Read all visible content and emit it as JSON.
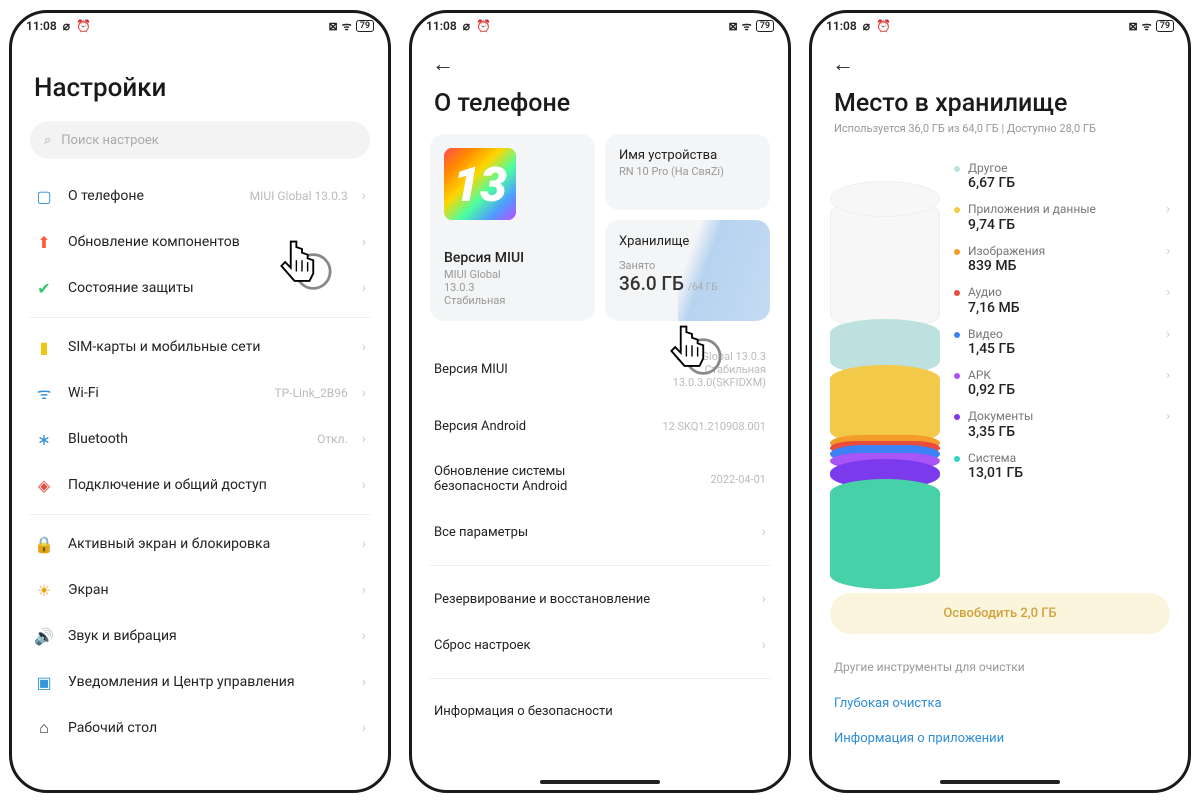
{
  "status": {
    "time": "11:08"
  },
  "screen1": {
    "title": "Настройки",
    "search_placeholder": "Поиск настроек",
    "g1": [
      {
        "id": "about-phone",
        "icon": "▢",
        "color": "#2e8dd9",
        "label": "О телефоне",
        "hint": "MIUI Global 13.0.3"
      },
      {
        "id": "update-components",
        "icon": "⬆",
        "color": "#ff5a3c",
        "label": "Обновление компонентов",
        "hint": ""
      },
      {
        "id": "security-status",
        "icon": "✔",
        "color": "#2ecc71",
        "label": "Состояние защиты",
        "hint": ""
      }
    ],
    "g2": [
      {
        "id": "sim-networks",
        "icon": "▮",
        "color": "#f1c40f",
        "label": "SIM-карты и мобильные сети",
        "hint": ""
      },
      {
        "id": "wifi",
        "icon": "ᯤ",
        "color": "#2e8dd9",
        "label": "Wi-Fi",
        "hint": "TP-Link_2B96"
      },
      {
        "id": "bluetooth",
        "icon": "∗",
        "color": "#2e8dd9",
        "label": "Bluetooth",
        "hint": "Откл."
      },
      {
        "id": "connection-sharing",
        "icon": "◈",
        "color": "#e74c3c",
        "label": "Подключение и общий доступ",
        "hint": ""
      }
    ],
    "g3": [
      {
        "id": "lock-screen",
        "icon": "🔒",
        "color": "#e74c3c",
        "label": "Активный экран и блокировка",
        "hint": ""
      },
      {
        "id": "display",
        "icon": "☀",
        "color": "#f39c12",
        "label": "Экран",
        "hint": ""
      },
      {
        "id": "sound",
        "icon": "🔊",
        "color": "#2ecc71",
        "label": "Звук и вибрация",
        "hint": ""
      },
      {
        "id": "notifications",
        "icon": "▣",
        "color": "#3498db",
        "label": "Уведомления и Центр управления",
        "hint": ""
      },
      {
        "id": "home-screen",
        "icon": "⌂",
        "color": "#333",
        "label": "Рабочий стол",
        "hint": ""
      }
    ]
  },
  "screen2": {
    "title": "О телефоне",
    "miui_card": {
      "label": "Версия MIUI",
      "line1": "MIUI Global",
      "line2": "13.0.3",
      "line3": "Стабильная"
    },
    "device_card": {
      "label": "Имя устройства",
      "value": "RN 10 Pro (На СвяZi)"
    },
    "storage_card": {
      "label": "Хранилище",
      "used_label": "Занято",
      "used": "36.0 ГБ",
      "total": "/64 ГБ"
    },
    "rows": [
      {
        "id": "miui-version",
        "label": "Версия MIUI",
        "val": "MIUI Global 13.0.3\nСтабильная\n13.0.3.0(SKFIDXM)"
      },
      {
        "id": "android-version",
        "label": "Версия Android",
        "val": "12 SKQ1.210908.001"
      },
      {
        "id": "security-update",
        "label": "Обновление системы безопасности Android",
        "val": "2022-04-01"
      },
      {
        "id": "all-specs",
        "label": "Все параметры",
        "val": "",
        "chev": true
      }
    ],
    "rows2": [
      {
        "id": "backup-restore",
        "label": "Резервирование и восстановление",
        "chev": true
      },
      {
        "id": "factory-reset",
        "label": "Сброс настроек",
        "chev": true
      }
    ],
    "rows3": [
      {
        "id": "security-info",
        "label": "Информация о безопасности"
      }
    ]
  },
  "screen3": {
    "title": "Место в хранилище",
    "subtitle": "Используется 36,0 ГБ из 64,0 ГБ | Доступно 28,0 ГБ",
    "legend": [
      {
        "id": "other",
        "color": "#bde1df",
        "name": "Другое",
        "val": "6,67 ГБ",
        "chev": false
      },
      {
        "id": "apps",
        "color": "#f3c94a",
        "name": "Приложения и данные",
        "val": "9,74 ГБ",
        "chev": true
      },
      {
        "id": "images",
        "color": "#f39c2a",
        "name": "Изображения",
        "val": "839 МБ",
        "chev": true
      },
      {
        "id": "audio",
        "color": "#e94b3c",
        "name": "Аудио",
        "val": "7,16 МБ",
        "chev": true
      },
      {
        "id": "video",
        "color": "#3b82f6",
        "name": "Видео",
        "val": "1,45 ГБ",
        "chev": true
      },
      {
        "id": "apk",
        "color": "#a855f7",
        "name": "APK",
        "val": "0,92 ГБ",
        "chev": true
      },
      {
        "id": "docs",
        "color": "#7c3aed",
        "name": "Документы",
        "val": "3,35 ГБ",
        "chev": true
      },
      {
        "id": "system",
        "color": "#2dd4bf",
        "name": "Система",
        "val": "13,01 ГБ",
        "chev": false
      }
    ],
    "free_btn": "Освободить 2,0 ГБ",
    "tools_header": "Другие инструменты для очистки",
    "tool1": "Глубокая очистка",
    "tool2": "Информация о приложении"
  }
}
